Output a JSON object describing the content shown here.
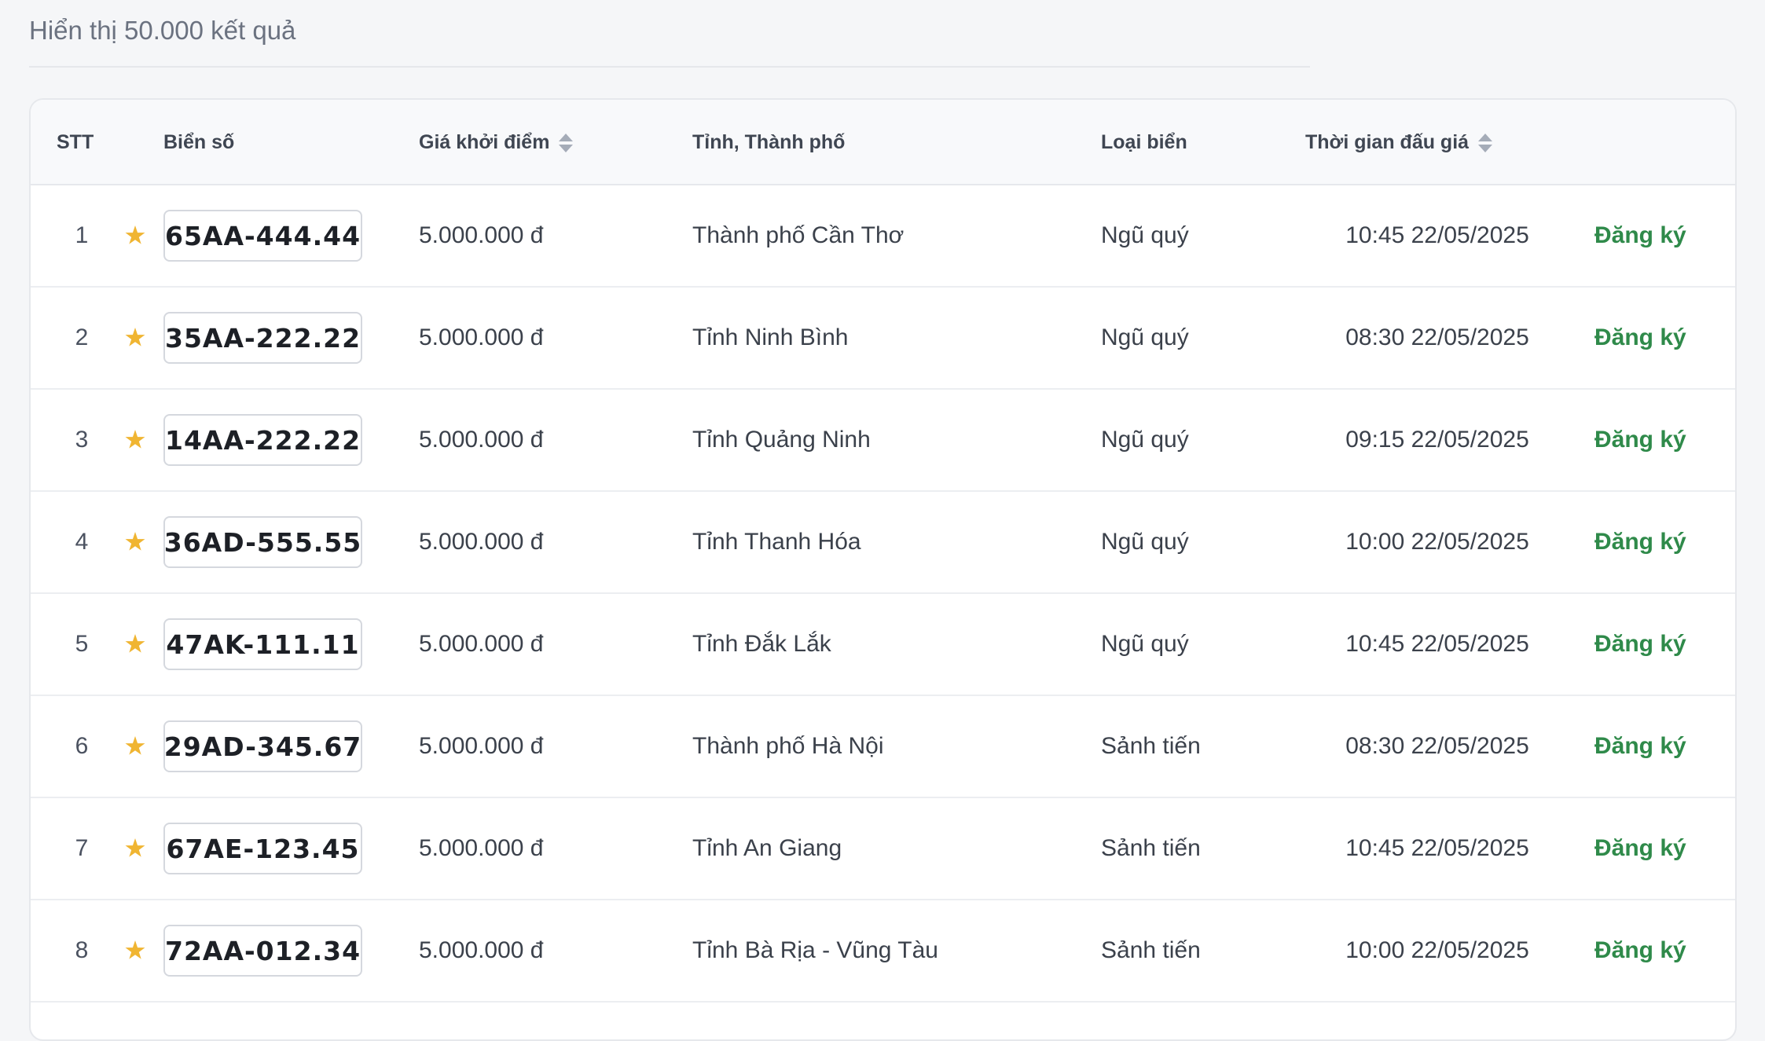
{
  "summary": {
    "text": "Hiển thị 50.000 kết quả"
  },
  "table": {
    "columns": {
      "stt": "STT",
      "plate": "Biển số",
      "price": "Giá khởi điểm",
      "city": "Tỉnh, Thành phố",
      "type": "Loại biển",
      "time": "Thời gian đấu giá"
    },
    "rows": [
      {
        "stt": "1",
        "plate": "65AA-444.44",
        "price": "5.000.000 đ",
        "city": "Thành phố Cần Thơ",
        "type": "Ngũ quý",
        "time": "10:45 22/05/2025",
        "action": "Đăng ký"
      },
      {
        "stt": "2",
        "plate": "35AA-222.22",
        "price": "5.000.000 đ",
        "city": "Tỉnh Ninh Bình",
        "type": "Ngũ quý",
        "time": "08:30 22/05/2025",
        "action": "Đăng ký"
      },
      {
        "stt": "3",
        "plate": "14AA-222.22",
        "price": "5.000.000 đ",
        "city": "Tỉnh Quảng Ninh",
        "type": "Ngũ quý",
        "time": "09:15 22/05/2025",
        "action": "Đăng ký"
      },
      {
        "stt": "4",
        "plate": "36AD-555.55",
        "price": "5.000.000 đ",
        "city": "Tỉnh Thanh Hóa",
        "type": "Ngũ quý",
        "time": "10:00 22/05/2025",
        "action": "Đăng ký"
      },
      {
        "stt": "5",
        "plate": "47AK-111.11",
        "price": "5.000.000 đ",
        "city": "Tỉnh Đắk Lắk",
        "type": "Ngũ quý",
        "time": "10:45 22/05/2025",
        "action": "Đăng ký"
      },
      {
        "stt": "6",
        "plate": "29AD-345.67",
        "price": "5.000.000 đ",
        "city": "Thành phố Hà Nội",
        "type": "Sảnh tiến",
        "time": "08:30 22/05/2025",
        "action": "Đăng ký"
      },
      {
        "stt": "7",
        "plate": "67AE-123.45",
        "price": "5.000.000 đ",
        "city": "Tỉnh An Giang",
        "type": "Sảnh tiến",
        "time": "10:45 22/05/2025",
        "action": "Đăng ký"
      },
      {
        "stt": "8",
        "plate": "72AA-012.34",
        "price": "5.000.000 đ",
        "city": "Tỉnh Bà Rịa - Vũng Tàu",
        "type": "Sảnh tiến",
        "time": "10:00 22/05/2025",
        "action": "Đăng ký"
      }
    ]
  },
  "icons": {
    "favorite": "star-icon",
    "sort": "sort-icon"
  },
  "colors": {
    "star": "#f0b532",
    "action": "#2f8a4a",
    "header_bg": "#f8f9fb"
  }
}
